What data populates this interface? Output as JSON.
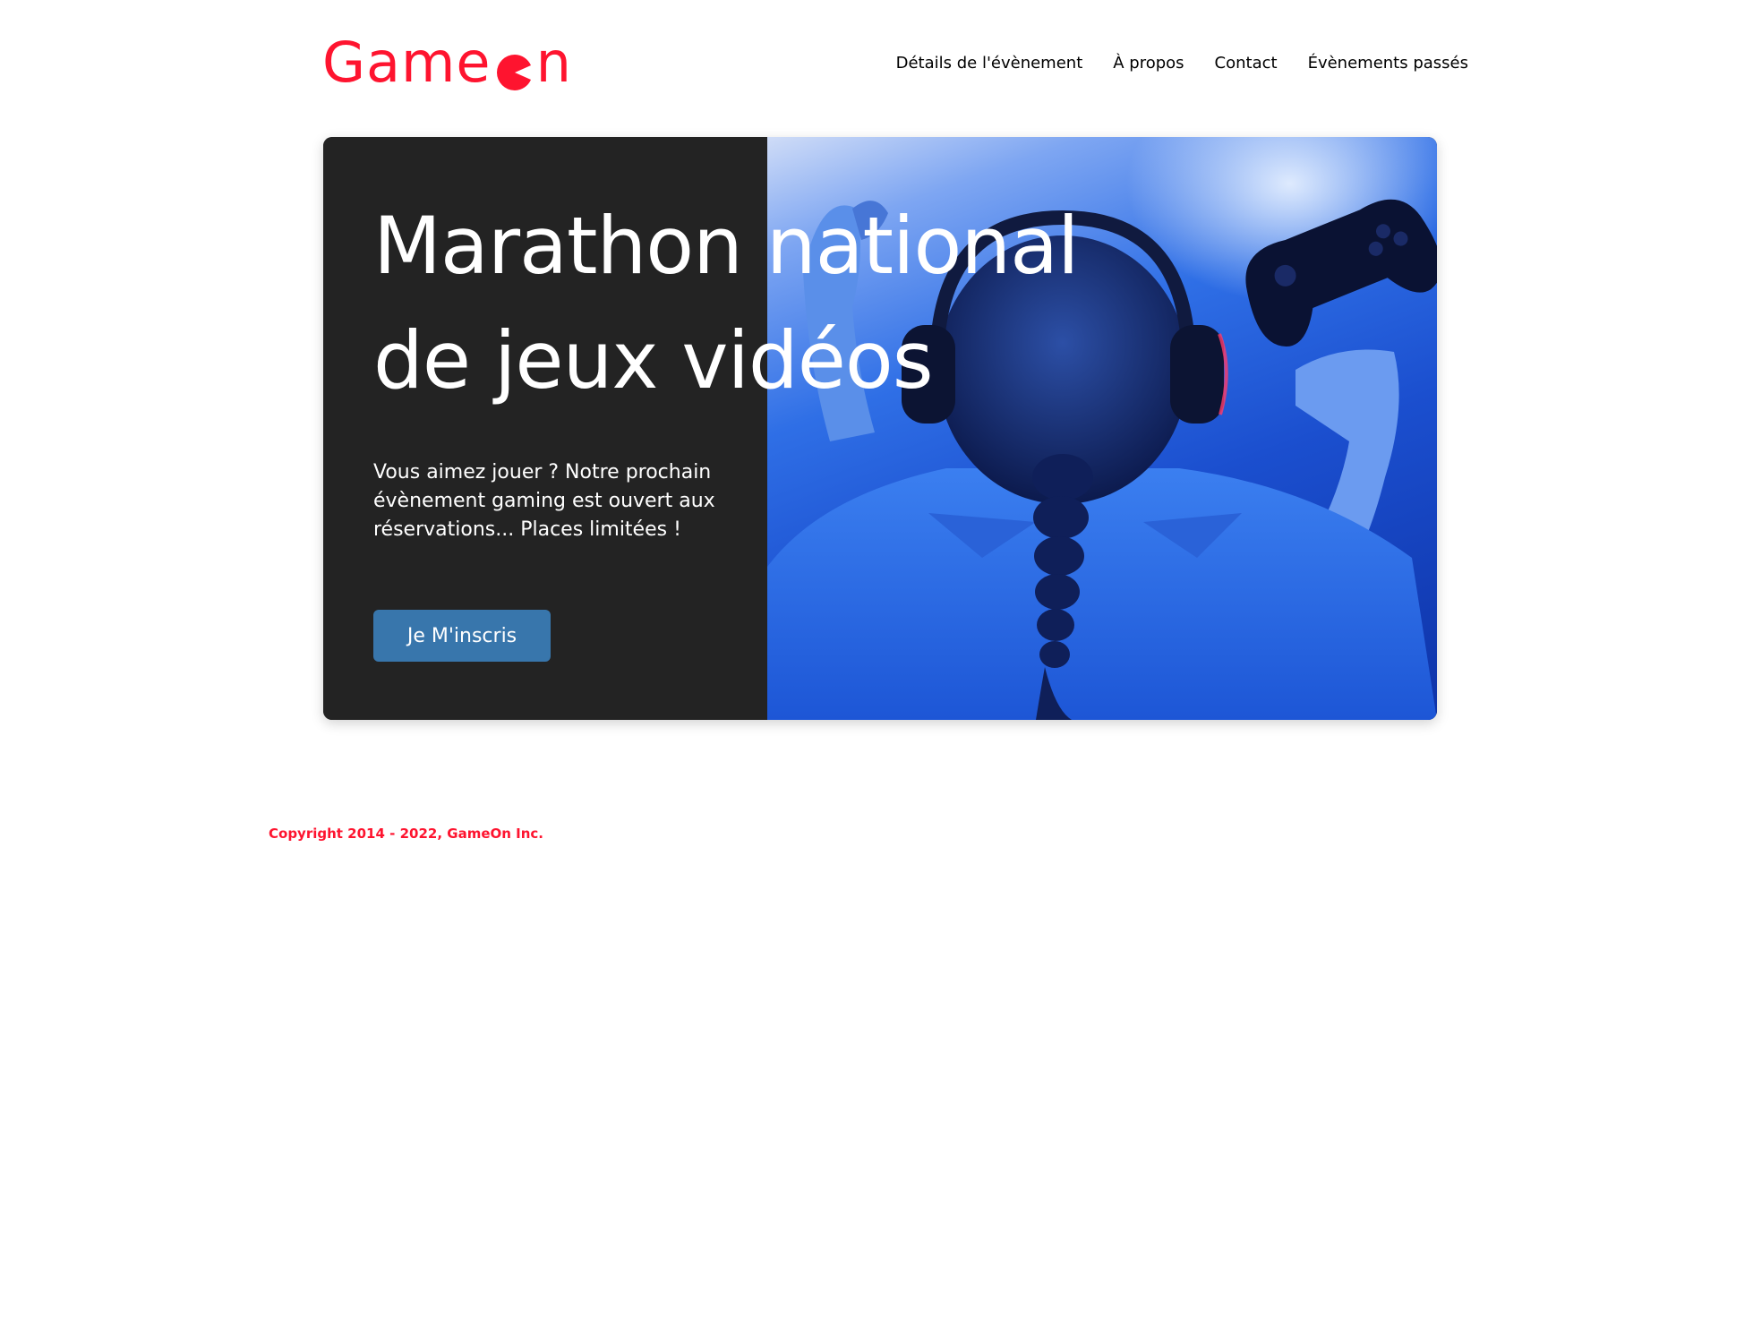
{
  "brand": {
    "name_prefix": "Game",
    "name_suffix": "n",
    "color": "#fe142f"
  },
  "nav": {
    "items": [
      {
        "label": "Détails de l'évènement"
      },
      {
        "label": "À propos"
      },
      {
        "label": "Contact"
      },
      {
        "label": "Évènements passés"
      }
    ]
  },
  "hero": {
    "title_line1": "Marathon national",
    "title_line2": "de jeux vidéos",
    "text": "Vous aimez jouer ? Notre prochain évènement gaming est ouvert aux réservations... Places limitées !",
    "cta_label": "Je M'inscris",
    "cta_color": "#3876ac",
    "panel_color": "#232323"
  },
  "footer": {
    "copyright": "Copyright 2014 - 2022, GameOn Inc."
  }
}
